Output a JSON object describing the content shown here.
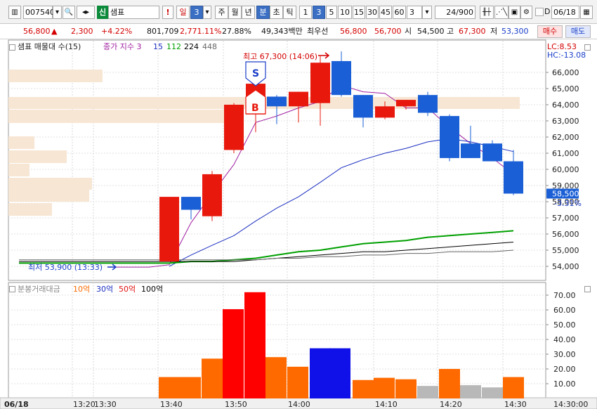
{
  "toolbar": {
    "code": "007540",
    "badge": "신",
    "name": "샘표",
    "warn": "!",
    "day": "일",
    "day_num": "3",
    "week": "주",
    "month": "월",
    "year": "년",
    "minute": "분",
    "second": "초",
    "tick": "틱",
    "intervals": [
      "1",
      "3",
      "5",
      "10",
      "15",
      "30",
      "45",
      "60"
    ],
    "selected_interval": "3",
    "period_value": "3",
    "count": "24/900",
    "checkbox_label": "D",
    "date": "06/18"
  },
  "quote": {
    "price": "56,800",
    "arrow": "▲",
    "change": "2,300",
    "change_pct": "+4.22%",
    "volume": "801,709",
    "volume_pct": "2,771.11%",
    "turnover_pct": "27.88%",
    "amount": "49,343백만",
    "best_label": "최우선",
    "best_ask": "56,800",
    "best_bid": "56,700",
    "open_label": "시",
    "open": "54,500",
    "high_label": "고",
    "high": "67,300",
    "low_label": "저",
    "low": "53,300",
    "buy": "매수",
    "sell": "매도"
  },
  "legend": {
    "upper": {
      "name": "샘표 매물대 수(15)",
      "ma_label": "종가 지수 3",
      "ma_values": [
        "15",
        "112",
        "224",
        "448"
      ],
      "ma_colors": [
        "#1a2ec0",
        "#00a000",
        "#000000",
        "#666666"
      ],
      "label_color": "#a020a0"
    },
    "lower": {
      "name": "분봉거래대금",
      "items": [
        "10억",
        "30억",
        "50억",
        "100억"
      ],
      "colors": [
        "#ff6a00",
        "#1a2ec0",
        "#e01010",
        "#000000"
      ]
    }
  },
  "annotations": {
    "high": "최고 67,300 (14:06)",
    "low": "최저 53,900 (13:33)",
    "lc": "LC:8.53",
    "hc": "HC:-13.08",
    "price_tag": "58,500",
    "price_pct": "-3.31%",
    "sell_marker": "S",
    "buy_marker": "B"
  },
  "colors": {
    "up": "#e8180c",
    "down": "#1a5fd6",
    "vol_orange": "#ff6a00",
    "vol_red": "#ff0000",
    "vol_blue": "#1010e8",
    "vol_gray": "#b8b8b8",
    "profile": "#f7e6d3"
  },
  "chart_data": [
    {
      "type": "candlestick",
      "y_axis_ticks": [
        "66,000",
        "65,000",
        "64,000",
        "63,000",
        "62,000",
        "61,000",
        "60,000",
        "59,000",
        "58,000",
        "57,000",
        "56,000",
        "55,000",
        "54,000"
      ],
      "ylim": [
        53600,
        67400
      ],
      "x_axis_ticks": [
        "06/18",
        "13:20",
        "13:30",
        "13:40",
        "13:50",
        "14:00",
        "14:10",
        "14:20",
        "14:30",
        "14:30:00"
      ],
      "candles": [
        {
          "open": 54300,
          "high": 55500,
          "low": 54300,
          "close": 58300
        },
        {
          "open": 58300,
          "high": 58300,
          "low": 56900,
          "close": 57500
        },
        {
          "open": 57100,
          "high": 59900,
          "low": 56800,
          "close": 59700
        },
        {
          "open": 61200,
          "high": 64100,
          "low": 61000,
          "close": 64000
        },
        {
          "open": 63400,
          "high": 65400,
          "low": 62300,
          "close": 65300
        },
        {
          "open": 64500,
          "high": 64600,
          "low": 62800,
          "close": 63900
        },
        {
          "open": 63900,
          "high": 64800,
          "low": 62900,
          "close": 64800
        },
        {
          "open": 64100,
          "high": 67000,
          "low": 62700,
          "close": 66600
        },
        {
          "open": 66700,
          "high": 67300,
          "low": 64500,
          "close": 64600
        },
        {
          "open": 64600,
          "high": 64600,
          "low": 62600,
          "close": 63200
        },
        {
          "open": 63200,
          "high": 64200,
          "low": 63100,
          "close": 63900
        },
        {
          "open": 63900,
          "high": 64300,
          "low": 63700,
          "close": 64300
        },
        {
          "open": 64600,
          "high": 64800,
          "low": 63300,
          "close": 63500
        },
        {
          "open": 63300,
          "high": 63400,
          "low": 60500,
          "close": 60700
        },
        {
          "open": 61600,
          "high": 62700,
          "low": 60700,
          "close": 60700
        },
        {
          "open": 61600,
          "high": 61800,
          "low": 60500,
          "close": 60500
        },
        {
          "open": 60500,
          "high": 61200,
          "low": 58400,
          "close": 58500
        }
      ],
      "moving_averages": [
        {
          "name": "3",
          "values": [
            54100,
            56700,
            58500,
            60300,
            62900,
            63300,
            63800,
            64200,
            65200,
            64800,
            64700,
            63800,
            63800,
            62600,
            61600,
            60700,
            59700
          ]
        },
        {
          "name": "15",
          "values": [
            54000,
            54700,
            55300,
            55900,
            56800,
            57600,
            58300,
            59200,
            60100,
            60600,
            61000,
            61300,
            61700,
            61900,
            61700,
            61400,
            61100
          ]
        },
        {
          "name": "112",
          "values": [
            54200,
            54300,
            54300,
            54400,
            54500,
            54700,
            54900,
            55000,
            55200,
            55400,
            55500,
            55600,
            55800,
            55900,
            56000,
            56100,
            56200
          ]
        },
        {
          "name": "224",
          "values": [
            54300,
            54300,
            54300,
            54300,
            54400,
            54500,
            54600,
            54700,
            54800,
            54900,
            54900,
            55000,
            55100,
            55200,
            55300,
            55400,
            55500
          ]
        },
        {
          "name": "448",
          "values": [
            54400,
            54400,
            54400,
            54400,
            54400,
            54500,
            54500,
            54600,
            54600,
            54700,
            54700,
            54800,
            54800,
            54900,
            54900,
            54900,
            55000
          ]
        }
      ]
    },
    {
      "type": "bar",
      "y_axis_ticks": [
        "70.00",
        "60.00",
        "50.00",
        "40.00",
        "30.00",
        "20.00",
        "10.00"
      ],
      "ylim": [
        0,
        72
      ],
      "values": [
        14.5,
        14.5,
        27,
        0,
        60.5,
        72,
        28,
        21.5,
        34,
        34,
        12.5,
        14,
        13,
        8.5,
        20,
        9,
        7.5,
        14.5
      ],
      "value_colors": [
        "orange",
        "orange",
        "orange",
        "none",
        "red",
        "red",
        "orange",
        "orange",
        "blue",
        "blue",
        "orange",
        "orange",
        "orange",
        "gray",
        "orange",
        "gray",
        "gray",
        "orange"
      ]
    }
  ]
}
